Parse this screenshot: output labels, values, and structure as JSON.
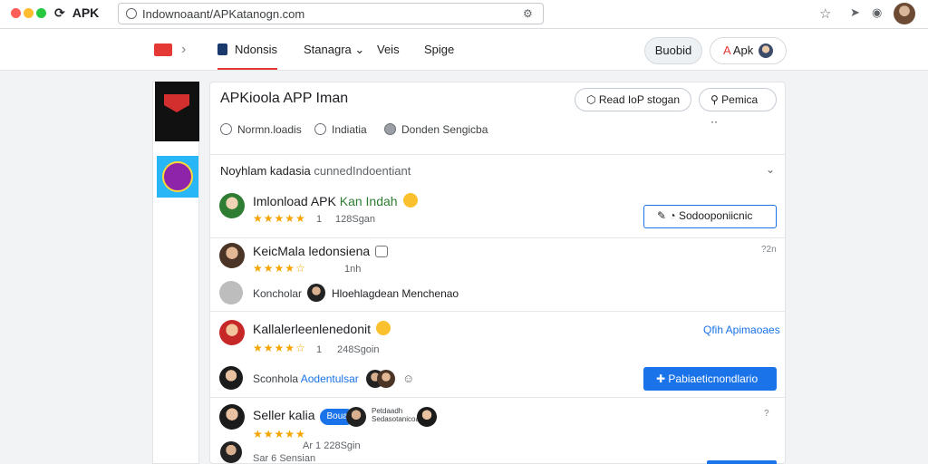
{
  "browser": {
    "tab_title": "APK",
    "url": "Indownoaant/APKatanogn.com",
    "colors": {
      "close": "#ff5f57",
      "min": "#febc2e",
      "max": "#28c840"
    }
  },
  "nav": {
    "tabs": [
      "Ndonsis",
      "Stanagra",
      "Veis",
      "Spige"
    ],
    "button_1": "Buobid",
    "button_2": "Apk"
  },
  "app": {
    "title": "APKioola APP Iman",
    "primary_button": "Read IoP stogan",
    "secondary_button": "Pemica",
    "meta": [
      "Normn.loadis",
      "Indiatia",
      "Donden Sengicba"
    ]
  },
  "reviews_section": {
    "title": "Noyhlam kadasia",
    "title_suffix": "cunnedIndoentiant",
    "reviews": [
      {
        "name": "Imlonload APK",
        "name_highlight": "Kan Indah",
        "rating": "★★★★★",
        "count": "1",
        "size": "128Sgan",
        "action": "Sodooponiicnic"
      },
      {
        "name": "KeicMala ledonsiena",
        "rating": "★★★★☆",
        "count": "1nh",
        "time": "?2n",
        "reply_label": "Koncholar",
        "reply_text": "Hloehlagdean Menchenao"
      },
      {
        "name": "Kallalerleenlenedonit",
        "rating": "★★★★☆",
        "count": "1",
        "size": "248Sgoin",
        "link": "Qfih Apimaoaes",
        "reply_label": "Sconhola",
        "reply_link": "Aodentulsar",
        "action": "Pabiaeticnondlario"
      },
      {
        "name": "Seller kalia",
        "tag": "Boua",
        "rating": "★★★★★",
        "meta": "Ar 1 228Sgin",
        "sub": "Sar 6 Sensian",
        "tiny_1": "Petdaadh",
        "tiny_2": "Sedasotanicoas",
        "time": "?"
      }
    ]
  }
}
